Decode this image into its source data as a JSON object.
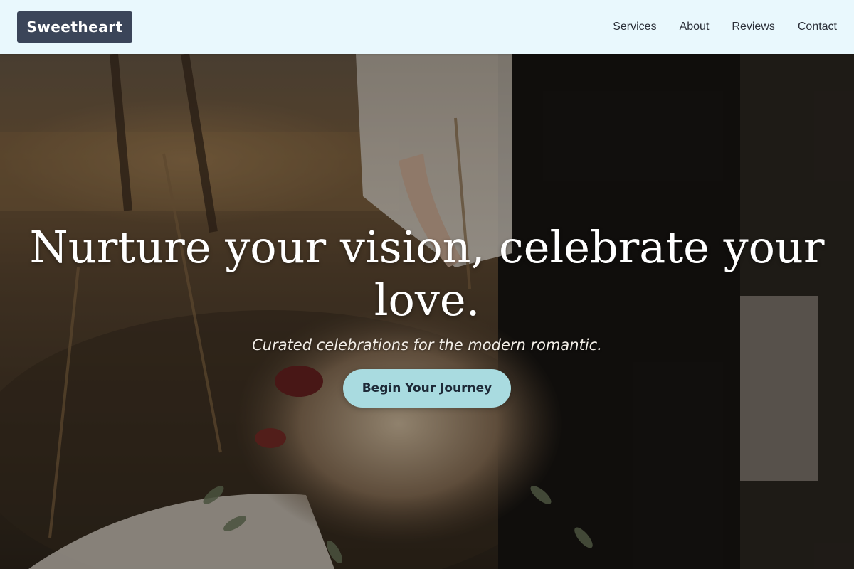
{
  "header": {
    "logo": "Sweetheart",
    "nav": [
      "Services",
      "About",
      "Reviews",
      "Contact"
    ]
  },
  "hero": {
    "headline": "Nurture your vision, celebrate your love.",
    "subtitle": "Curated celebrations for the modern romantic.",
    "cta_label": "Begin Your Journey",
    "background_description": "Couple holding dried flower bouquet in a field"
  },
  "colors": {
    "header_bg": "#e9f8fd",
    "logo_bg": "#3b4559",
    "cta_bg": "#a9dbe0",
    "text_dark": "#2b2f38"
  }
}
